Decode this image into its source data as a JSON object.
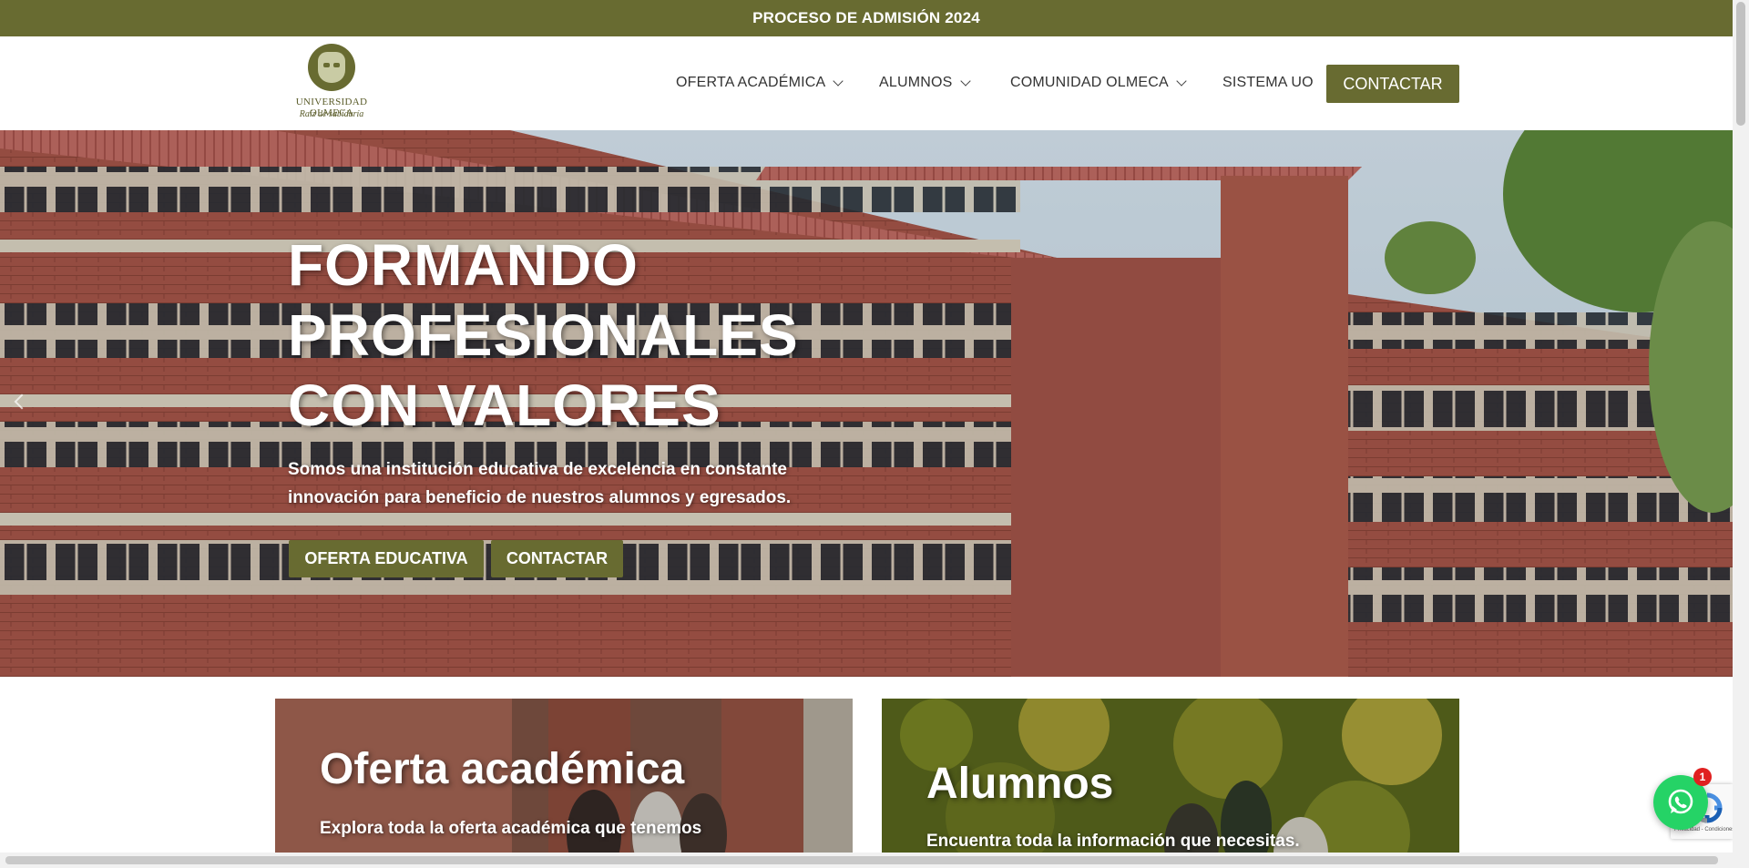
{
  "topbar": {
    "text": "PROCESO DE ADMISIÓN 2024"
  },
  "logo": {
    "name": "UNIVERSIDAD OLMECA",
    "motto": "Raíz de sabiduría"
  },
  "nav": {
    "items": [
      {
        "label": "OFERTA ACADÉMICA",
        "has_dropdown": true
      },
      {
        "label": "ALUMNOS",
        "has_dropdown": true
      },
      {
        "label": "COMUNIDAD OLMECA",
        "has_dropdown": true
      },
      {
        "label": "SISTEMA UO",
        "has_dropdown": false
      }
    ],
    "contact_button": "CONTACTAR"
  },
  "hero": {
    "title_lines": [
      "FORMANDO",
      "PROFESIONALES",
      "CON VALORES"
    ],
    "subtitle_lines": [
      "Somos una institución educativa de excelencia en constante",
      "innovación para beneficio de nuestros alumnos y egresados."
    ],
    "buttons": [
      "OFERTA EDUCATIVA",
      "CONTACTAR"
    ]
  },
  "cards": [
    {
      "title": "Oferta académica",
      "text": "Explora toda la oferta académica que tenemos"
    },
    {
      "title": "Alumnos",
      "text": "Encuentra toda la información que necesitas."
    }
  ],
  "whatsapp": {
    "badge_count": "1"
  },
  "recaptcha": {
    "text": "Privacidad - Condiciones"
  },
  "colors": {
    "brand_olive": "#686b31",
    "whatsapp_green": "#25d366"
  },
  "icons": [
    "chevron-down-icon",
    "chevron-left-icon",
    "whatsapp-icon",
    "recaptcha-icon"
  ]
}
